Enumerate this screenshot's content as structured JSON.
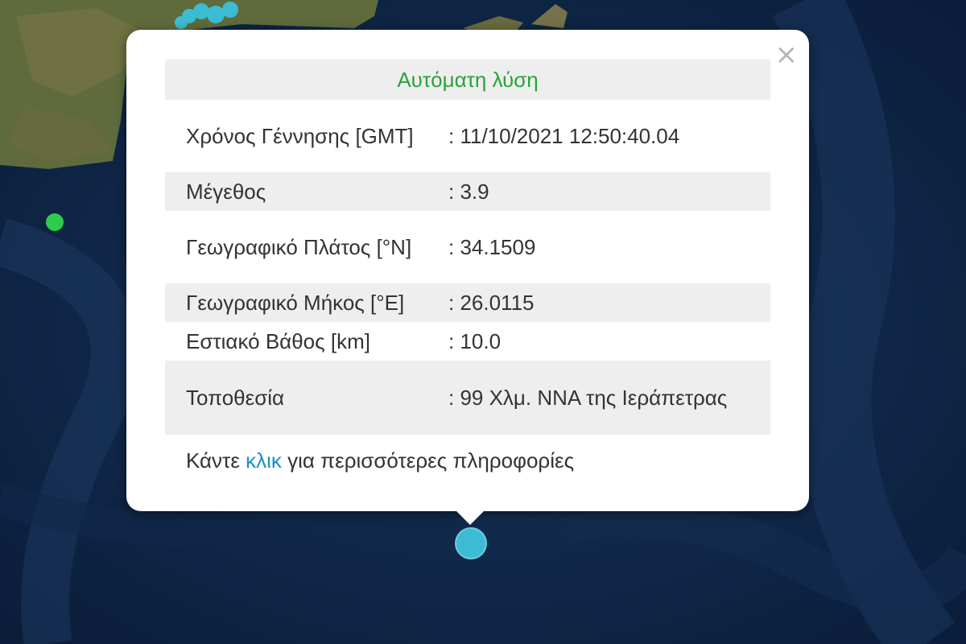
{
  "map": {
    "colors": {
      "sea": "#0d2345",
      "land": "#5b6a3b",
      "event_main": "#3bbcd3",
      "event_green": "#2ecc4a"
    },
    "markers": [
      {
        "name": "selected-event",
        "color": "#3bbcd3"
      },
      {
        "name": "other-event",
        "color": "#2ecc4a"
      }
    ]
  },
  "popup": {
    "close_label": "×",
    "title": "Αυτόματη λύση",
    "rows": [
      {
        "label": "Χρόνος Γέννησης [GMT]",
        "value": ": 11/10/2021 12:50:40.04"
      },
      {
        "label": "Μέγεθος",
        "value": ": 3.9"
      },
      {
        "label": "Γεωγραφικό Πλάτος [°N]",
        "value": ": 34.1509"
      },
      {
        "label": "Γεωγραφικό Μήκος [°E]",
        "value": ": 26.0115"
      },
      {
        "label": "Εστιακό Βάθος [km]",
        "value": ": 10.0"
      },
      {
        "label": "Τοποθεσία",
        "value": ": 99 Χλμ. ΝΝΑ της Ιεράπετρας"
      }
    ],
    "footer": {
      "before": "Κάντε ",
      "link": "κλικ",
      "after": " για περισσότερες πληροφορίες"
    }
  }
}
